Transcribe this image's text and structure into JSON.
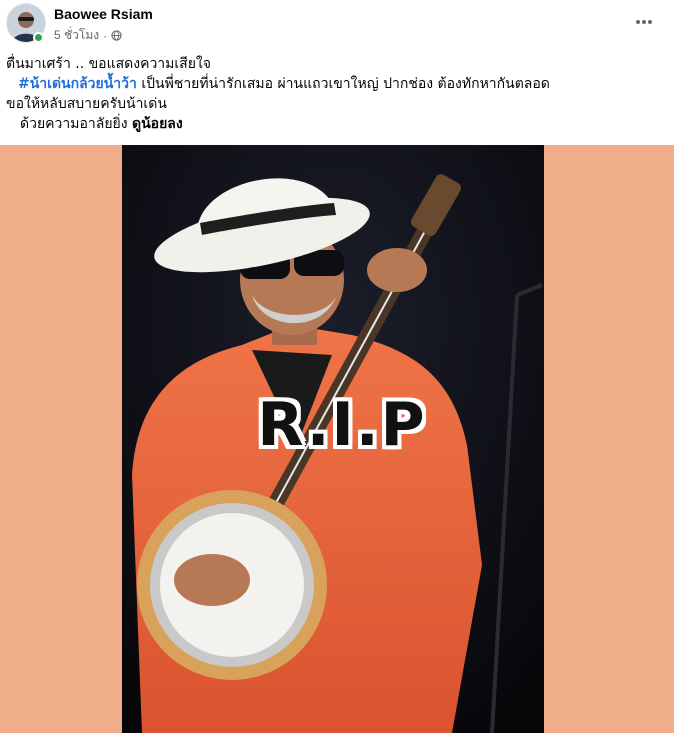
{
  "post": {
    "author": "Baowee Rsiam",
    "time": "5 ชั่วโมง",
    "separator": "·",
    "privacy_icon": "globe-icon",
    "more_icon": "more-horizontal-icon",
    "online": true
  },
  "caption": {
    "line1": "ตื่นมาเศร้า .. ขอแสดงความเสียใจ",
    "line2_hashtag": "#น้าเด่นกล้วยน้ำว้า",
    "line2_text": " เป็นพี่ชายที่น่ารักเสมอ ผ่านแถวเขาใหญ่ ปากช่อง ต้องทักหากันตลอด",
    "line3": "ขอให้หลับสบายครับน้าเด่น",
    "line4_text": "ด้วยความอาลัยยิ่ง ",
    "line4_bold": "ดูน้อยลง"
  },
  "photo": {
    "overlay_text": "R.I.P",
    "side_color": "#f0ad89"
  }
}
